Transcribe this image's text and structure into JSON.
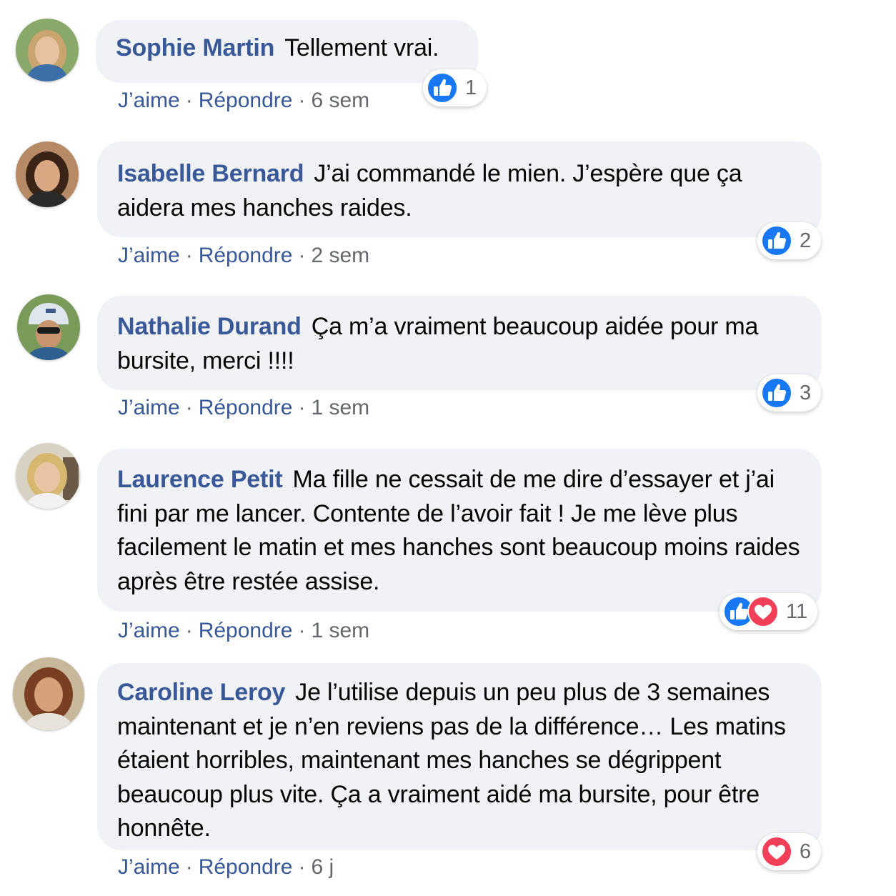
{
  "colors": {
    "author": "#385898",
    "link": "#385898",
    "meta": "#65676b",
    "bubble": "#f0f2f5",
    "like": "#1877f2",
    "love": "#f33e58"
  },
  "comments": [
    {
      "author": "Sophie Martin",
      "text": "Tellement vrai.",
      "like_label": "J’aime",
      "reply_label": "Répondre",
      "time": "6 sem",
      "reactions": [
        "like-icon"
      ],
      "reaction_count": "1"
    },
    {
      "author": "Isabelle Bernard",
      "text": "J’ai commandé le mien. J’espère que ça aidera mes hanches raides.",
      "like_label": "J’aime",
      "reply_label": "Répondre",
      "time": "2 sem",
      "reactions": [
        "like-icon"
      ],
      "reaction_count": "2"
    },
    {
      "author": "Nathalie Durand",
      "text": "Ça m’a vraiment beaucoup aidée pour ma bursite, merci !!!!",
      "like_label": "J’aime",
      "reply_label": "Répondre",
      "time": "1 sem",
      "reactions": [
        "like-icon"
      ],
      "reaction_count": "3"
    },
    {
      "author": "Laurence Petit",
      "text": "Ma fille ne cessait de me dire d’essayer et j’ai fini par me lancer. Contente de l’avoir fait ! Je me lève plus facilement le matin et mes hanches sont beaucoup moins raides après être restée assise.",
      "like_label": "J’aime",
      "reply_label": "Répondre",
      "time": "1 sem",
      "reactions": [
        "like-icon",
        "heart-icon"
      ],
      "reaction_count": "11"
    },
    {
      "author": "Caroline Leroy",
      "text": "Je l’utilise depuis un peu plus de 3 semaines maintenant et je n’en reviens pas de la différence… Les matins étaient horribles, maintenant mes hanches se dégrippent beaucoup plus vite. Ça a vraiment aidé ma bursite, pour être honnête.",
      "like_label": "J’aime",
      "reply_label": "Répondre",
      "time": "6 j",
      "reactions": [
        "heart-icon"
      ],
      "reaction_count": "6"
    }
  ]
}
